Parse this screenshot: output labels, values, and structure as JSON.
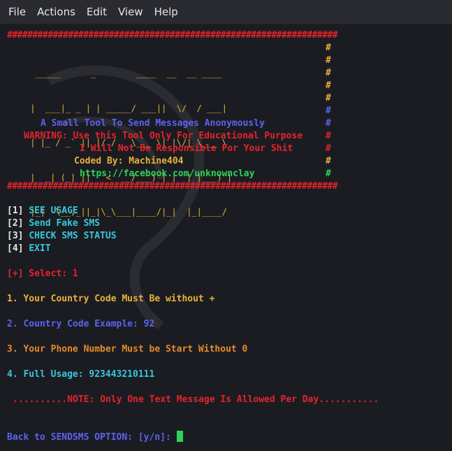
{
  "menubar": {
    "items": [
      {
        "label": "File"
      },
      {
        "label": "Actions"
      },
      {
        "label": "Edit"
      },
      {
        "label": "View"
      },
      {
        "label": "Help"
      }
    ]
  },
  "terminal": {
    "border_top": "#################################################################",
    "border_bottom": "#################################################################",
    "logo": [
      "  _____      _        ____  __  __ ____",
      " |  ___|_ _ | | _____/ ___||  \\/  / ___|",
      " | |_ / _` || |/ / _ \\___ \\| |\\/| \\___ \\",
      " |  _| (_| ||   <  __/___) | |  | |___) |",
      " |_|  \\__,_||_|\\_\\___|____/|_|  |_|____/"
    ],
    "hash_char": "#",
    "tagline": "A Small Tool To Send Messages Anonymously",
    "warning": "WARNING: Use this Tool Only For Educational Purpose",
    "responsibility": "I Will Not Be Responsible For Your Shit",
    "coded_by": "Coded By: Machine404",
    "link": "https://facebook.com/unknownclay",
    "menu": [
      {
        "num": "[1]",
        "label": "SEE USAGE"
      },
      {
        "num": "[2]",
        "label": "Send Fake SMS"
      },
      {
        "num": "[3]",
        "label": "CHECK SMS STATUS"
      },
      {
        "num": "[4]",
        "label": "EXIT"
      }
    ],
    "select_prompt": "[+] Select: 1",
    "usage": [
      "1. Your Country Code Must Be without +",
      "2. Country Code Example: 92",
      "3. Your Phone Number Must be Start Without 0",
      "4. Full Usage: 923443210111"
    ],
    "note": "..........NOTE: Only One Text Message Is Allowed Per Day...........",
    "back_prompt": "Back to SENDSMS OPTION: [y/n]:"
  },
  "colors": {
    "red": "#e4242a",
    "blue": "#5b63ee",
    "yellow": "#e8b23a",
    "green": "#2fd35a",
    "cyan": "#39c7d9",
    "orange": "#e58a2c",
    "background": "#1b1c22"
  }
}
